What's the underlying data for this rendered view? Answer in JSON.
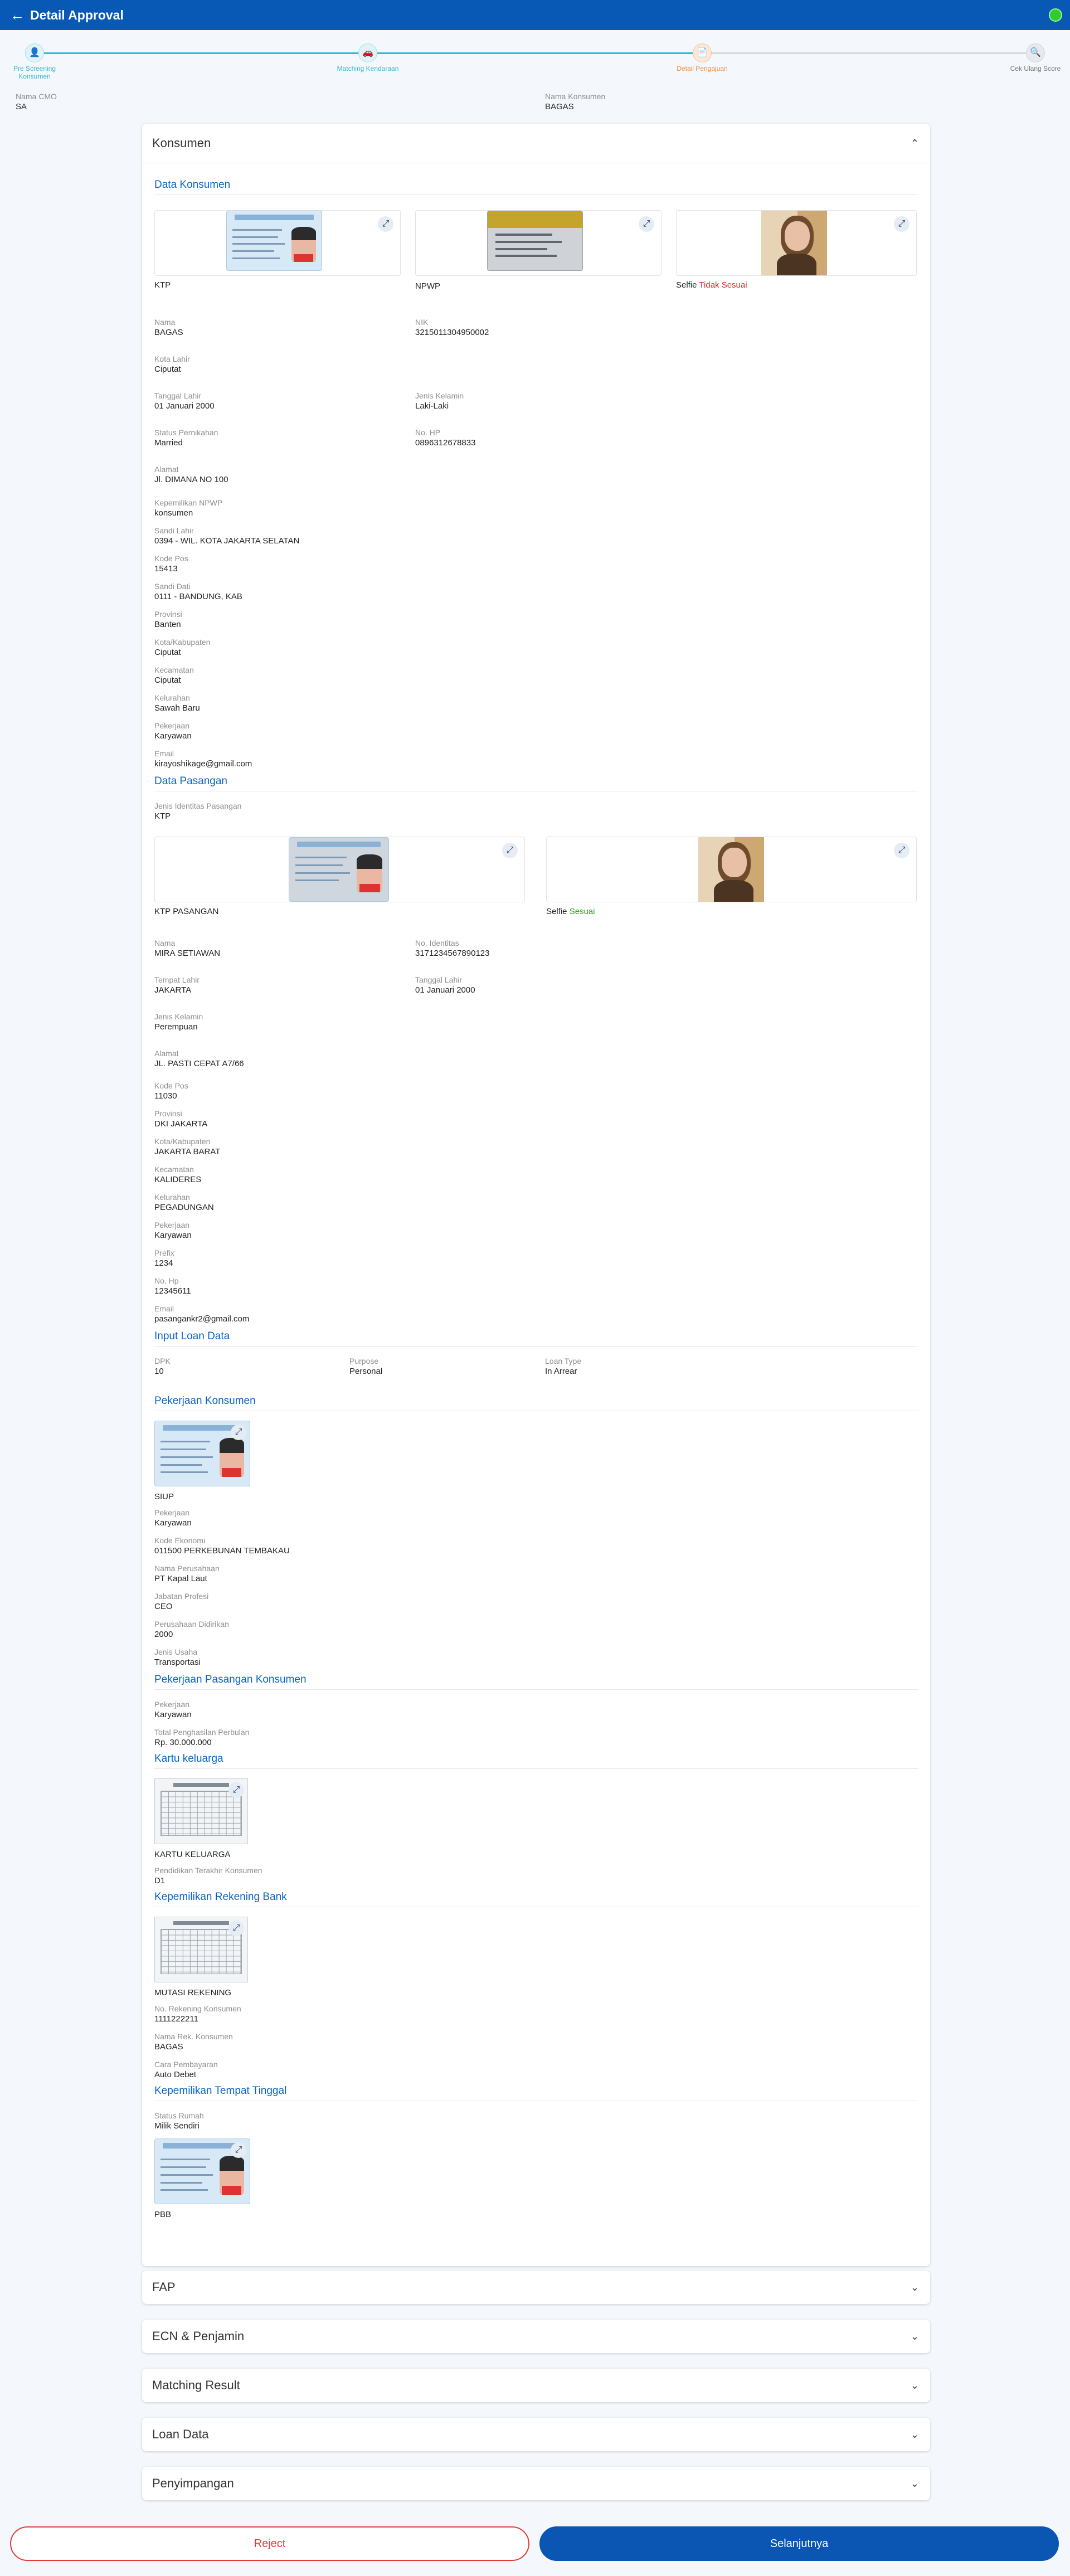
{
  "header": {
    "title": "Detail Approval"
  },
  "stepper": [
    {
      "label": "Pre Screening Konsumen",
      "icon": "person-check-icon"
    },
    {
      "label": "Matching Kendaraan",
      "icon": "car-icon"
    },
    {
      "label": "Detail Pengajuan",
      "icon": "document-icon"
    },
    {
      "label": "Cek Ulang Score",
      "icon": "magnifier-icon"
    }
  ],
  "cmo": {
    "nama_cmo_label": "Nama CMO",
    "nama_cmo": "SA",
    "nama_konsumen_label": "Nama Konsumen",
    "nama_konsumen": "BAGAS"
  },
  "konsumen": {
    "title": "Konsumen",
    "data_konsumen": {
      "title": "Data Konsumen",
      "docs": [
        {
          "label": "KTP"
        },
        {
          "label": "NPWP"
        },
        {
          "label": "Selfie ",
          "status": "Tidak Sesuai"
        }
      ],
      "fields": {
        "nama": {
          "label": "Nama",
          "value": "BAGAS"
        },
        "nik": {
          "label": "NIK",
          "value": "3215011304950002"
        },
        "kota_lahir": {
          "label": "Kota Lahir",
          "value": "Ciputat"
        },
        "tanggal_lahir": {
          "label": "Tanggal Lahir",
          "value": "01 Januari 2000"
        },
        "jenis_kelamin": {
          "label": "Jenis Kelamin",
          "value": "Laki-Laki"
        },
        "status_pernikahan": {
          "label": "Status Pernikahan",
          "value": "Married"
        },
        "no_hp": {
          "label": "No. HP",
          "value": "0896312678833"
        },
        "alamat": {
          "label": "Alamat",
          "value": "Jl. DIMANA NO 100"
        },
        "kepemilikan_npwp": {
          "label": "Kepemilikan NPWP",
          "value": "konsumen"
        },
        "sandi_lahir": {
          "label": "Sandi Lahir",
          "value": "0394 - WIL. KOTA JAKARTA SELATAN"
        },
        "kode_pos": {
          "label": "Kode Pos",
          "value": "15413"
        },
        "sandi_dati": {
          "label": "Sandi Dati",
          "value": "0111 - BANDUNG, KAB"
        },
        "provinsi": {
          "label": "Provinsi",
          "value": "Banten"
        },
        "kota_kabupaten": {
          "label": "Kota/Kabupaten",
          "value": "Ciputat"
        },
        "kecamatan": {
          "label": "Kecamatan",
          "value": "Ciputat"
        },
        "kelurahan": {
          "label": "Kelurahan",
          "value": "Sawah Baru"
        },
        "pekerjaan": {
          "label": "Pekerjaan",
          "value": "Karyawan"
        },
        "email": {
          "label": "Email",
          "value": "kirayoshikage@gmail.com"
        }
      }
    },
    "data_pasangan": {
      "title": "Data Pasangan",
      "jenis_identitas": {
        "label": "Jenis Identitas Pasangan",
        "value": "KTP"
      },
      "docs": [
        {
          "label": "KTP PASANGAN"
        },
        {
          "label": "Selfie ",
          "status": "Sesuai"
        }
      ],
      "fields": {
        "nama": {
          "label": "Nama",
          "value": "MIRA SETIAWAN"
        },
        "no_identitas": {
          "label": "No. Identitas",
          "value": "3171234567890123"
        },
        "tempat_lahir": {
          "label": "Tempat Lahir",
          "value": "JAKARTA"
        },
        "tanggal_lahir": {
          "label": "Tanggal Lahir",
          "value": "01 Januari 2000"
        },
        "jenis_kelamin": {
          "label": "Jenis Kelamin",
          "value": "Perempuan"
        },
        "alamat": {
          "label": "Alamat",
          "value": "JL. PASTI CEPAT A7/66"
        },
        "kode_pos": {
          "label": "Kode Pos",
          "value": "11030"
        },
        "provinsi": {
          "label": "Provinsi",
          "value": "DKI JAKARTA"
        },
        "kota_kabupaten": {
          "label": "Kota/Kabupaten",
          "value": "JAKARTA BARAT"
        },
        "kecamatan": {
          "label": "Kecamatan",
          "value": "KALIDERES"
        },
        "kelurahan": {
          "label": "Kelurahan",
          "value": "PEGADUNGAN"
        },
        "pekerjaan": {
          "label": "Pekerjaan",
          "value": "Karyawan"
        },
        "prefix": {
          "label": "Prefix",
          "value": "1234"
        },
        "no_hp": {
          "label": "No. Hp",
          "value": "12345611"
        },
        "email": {
          "label": "Email",
          "value": "pasangankr2@gmail.com"
        }
      }
    },
    "input_loan": {
      "title": "Input Loan Data",
      "dpk": {
        "label": "DPK",
        "value": "10"
      },
      "purpose": {
        "label": "Purpose",
        "value": "Personal"
      },
      "loan_type": {
        "label": "Loan Type",
        "value": "In Arrear"
      }
    },
    "pekerjaan_konsumen": {
      "title": "Pekerjaan Konsumen",
      "doc_label": "SIUP",
      "pekerjaan": {
        "label": "Pekerjaan",
        "value": "Karyawan"
      },
      "kode_ekonomi": {
        "label": "Kode Ekonomi",
        "value": "011500 PERKEBUNAN TEMBAKAU"
      },
      "nama_perusahaan": {
        "label": "Nama Perusahaan",
        "value": "PT Kapal Laut"
      },
      "jabatan_profesi": {
        "label": "Jabatan Profesi",
        "value": "CEO"
      },
      "perusahaan_didirikan": {
        "label": "Perusahaan Didirikan",
        "value": "2000"
      },
      "jenis_usaha": {
        "label": "Jenis Usaha",
        "value": "Transportasi"
      }
    },
    "pekerjaan_pasangan": {
      "title": "Pekerjaan Pasangan Konsumen",
      "pekerjaan": {
        "label": "Pekerjaan",
        "value": "Karyawan"
      },
      "total_penghasilan": {
        "label": "Total Penghasilan Perbulan",
        "value": "Rp. 30.000.000"
      }
    },
    "kartu_keluarga": {
      "title": "Kartu keluarga",
      "doc_label": "KARTU KELUARGA",
      "pendidikan": {
        "label": "Pendidikan Terakhir Konsumen",
        "value": "D1"
      }
    },
    "rekening_bank": {
      "title": "Kepemilikan Rekening Bank",
      "doc_label": "MUTASI REKENING",
      "no_rekening": {
        "label": "No. Rekening Konsumen",
        "value": "1111222211"
      },
      "nama_rek": {
        "label": "Nama Rek. Konsumen",
        "value": "BAGAS"
      },
      "cara_pembayaran": {
        "label": "Cara Pembayaran",
        "value": "Auto Debet"
      }
    },
    "tempat_tinggal": {
      "title": "Kepemilikan Tempat Tinggal",
      "status_rumah": {
        "label": "Status Rumah",
        "value": "Milik Sendiri"
      },
      "doc_label": "PBB"
    }
  },
  "sections": [
    "FAP",
    "ECN & Penjamin",
    "Matching Result",
    "Loan Data",
    "Penyimpangan"
  ],
  "buttons": {
    "reject": "Reject",
    "next": "Selanjutnya"
  }
}
